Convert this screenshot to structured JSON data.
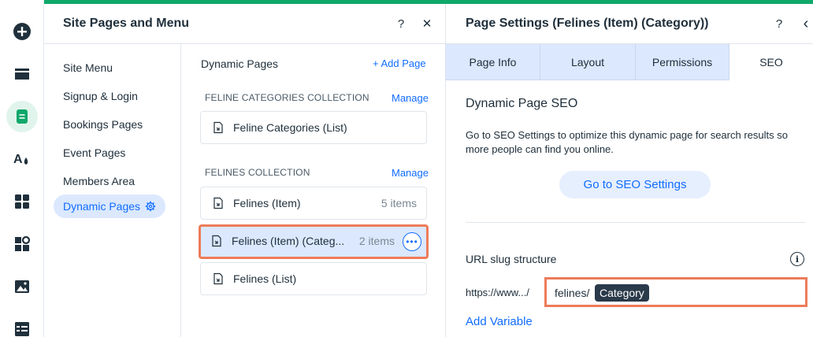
{
  "rail": {
    "items": [
      {
        "name": "add-icon"
      },
      {
        "name": "sections-icon"
      },
      {
        "name": "pages-icon"
      },
      {
        "name": "design-icon"
      },
      {
        "name": "apps-icon"
      },
      {
        "name": "add-apps-icon"
      },
      {
        "name": "media-icon"
      },
      {
        "name": "cms-icon"
      }
    ]
  },
  "site_pages": {
    "title": "Site Pages and Menu",
    "help_icon": "?",
    "close_icon": "✕",
    "menu": [
      {
        "label": "Site Menu"
      },
      {
        "label": "Signup & Login"
      },
      {
        "label": "Bookings Pages"
      },
      {
        "label": "Event Pages"
      },
      {
        "label": "Members Area"
      },
      {
        "label": "Dynamic Pages"
      }
    ],
    "dynamic": {
      "title": "Dynamic Pages",
      "add_page": "+ Add Page",
      "collections": [
        {
          "title": "FELINE CATEGORIES COLLECTION",
          "manage": "Manage",
          "pages": [
            {
              "label": "Feline Categories (List)",
              "count": ""
            }
          ]
        },
        {
          "title": "FELINES COLLECTION",
          "manage": "Manage",
          "pages": [
            {
              "label": "Felines (Item)",
              "count": "5 items"
            },
            {
              "label": "Felines (Item) (Categ...",
              "count": "2 items"
            },
            {
              "label": "Felines (List)",
              "count": ""
            }
          ]
        }
      ]
    }
  },
  "page_settings": {
    "title": "Page Settings (Felines (Item) (Category))",
    "help_icon": "?",
    "back_icon": "‹",
    "tabs": [
      {
        "label": "Page Info"
      },
      {
        "label": "Layout"
      },
      {
        "label": "Permissions"
      },
      {
        "label": "SEO"
      }
    ],
    "seo": {
      "title": "Dynamic Page SEO",
      "description": "Go to SEO Settings to optimize this dynamic page for search results so more people can find you online.",
      "button": "Go to SEO Settings",
      "slug_label": "URL slug structure",
      "slug_prefix": "https://www.../",
      "slug_value": "felines/",
      "slug_variable": "Category",
      "add_variable": "Add Variable"
    }
  },
  "colors": {
    "accent": "#116dff",
    "green": "#0fa86b",
    "highlight": "#ee7b59"
  }
}
